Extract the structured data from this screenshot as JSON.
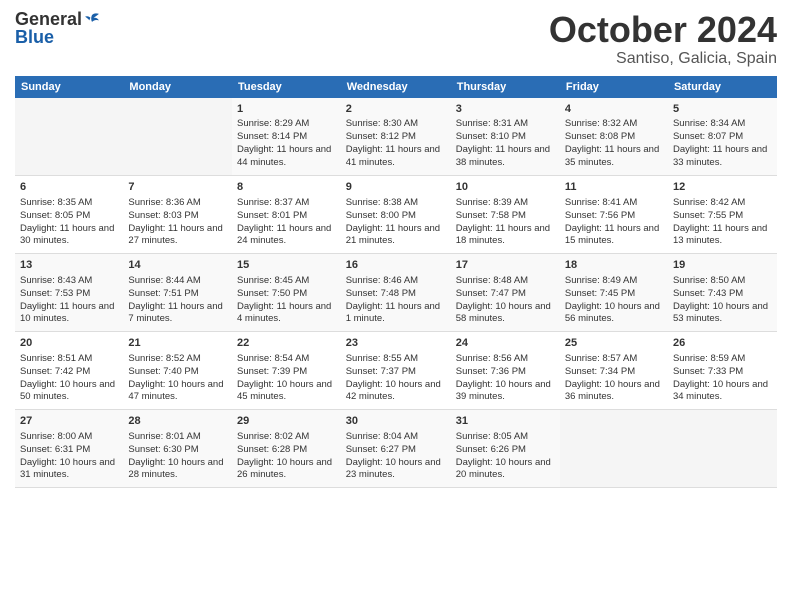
{
  "header": {
    "logo_general": "General",
    "logo_blue": "Blue",
    "month": "October 2024",
    "location": "Santiso, Galicia, Spain"
  },
  "weekdays": [
    "Sunday",
    "Monday",
    "Tuesday",
    "Wednesday",
    "Thursday",
    "Friday",
    "Saturday"
  ],
  "weeks": [
    [
      {
        "day": "",
        "info": ""
      },
      {
        "day": "",
        "info": ""
      },
      {
        "day": "1",
        "info": "Sunrise: 8:29 AM\nSunset: 8:14 PM\nDaylight: 11 hours and 44 minutes."
      },
      {
        "day": "2",
        "info": "Sunrise: 8:30 AM\nSunset: 8:12 PM\nDaylight: 11 hours and 41 minutes."
      },
      {
        "day": "3",
        "info": "Sunrise: 8:31 AM\nSunset: 8:10 PM\nDaylight: 11 hours and 38 minutes."
      },
      {
        "day": "4",
        "info": "Sunrise: 8:32 AM\nSunset: 8:08 PM\nDaylight: 11 hours and 35 minutes."
      },
      {
        "day": "5",
        "info": "Sunrise: 8:34 AM\nSunset: 8:07 PM\nDaylight: 11 hours and 33 minutes."
      }
    ],
    [
      {
        "day": "6",
        "info": "Sunrise: 8:35 AM\nSunset: 8:05 PM\nDaylight: 11 hours and 30 minutes."
      },
      {
        "day": "7",
        "info": "Sunrise: 8:36 AM\nSunset: 8:03 PM\nDaylight: 11 hours and 27 minutes."
      },
      {
        "day": "8",
        "info": "Sunrise: 8:37 AM\nSunset: 8:01 PM\nDaylight: 11 hours and 24 minutes."
      },
      {
        "day": "9",
        "info": "Sunrise: 8:38 AM\nSunset: 8:00 PM\nDaylight: 11 hours and 21 minutes."
      },
      {
        "day": "10",
        "info": "Sunrise: 8:39 AM\nSunset: 7:58 PM\nDaylight: 11 hours and 18 minutes."
      },
      {
        "day": "11",
        "info": "Sunrise: 8:41 AM\nSunset: 7:56 PM\nDaylight: 11 hours and 15 minutes."
      },
      {
        "day": "12",
        "info": "Sunrise: 8:42 AM\nSunset: 7:55 PM\nDaylight: 11 hours and 13 minutes."
      }
    ],
    [
      {
        "day": "13",
        "info": "Sunrise: 8:43 AM\nSunset: 7:53 PM\nDaylight: 11 hours and 10 minutes."
      },
      {
        "day": "14",
        "info": "Sunrise: 8:44 AM\nSunset: 7:51 PM\nDaylight: 11 hours and 7 minutes."
      },
      {
        "day": "15",
        "info": "Sunrise: 8:45 AM\nSunset: 7:50 PM\nDaylight: 11 hours and 4 minutes."
      },
      {
        "day": "16",
        "info": "Sunrise: 8:46 AM\nSunset: 7:48 PM\nDaylight: 11 hours and 1 minute."
      },
      {
        "day": "17",
        "info": "Sunrise: 8:48 AM\nSunset: 7:47 PM\nDaylight: 10 hours and 58 minutes."
      },
      {
        "day": "18",
        "info": "Sunrise: 8:49 AM\nSunset: 7:45 PM\nDaylight: 10 hours and 56 minutes."
      },
      {
        "day": "19",
        "info": "Sunrise: 8:50 AM\nSunset: 7:43 PM\nDaylight: 10 hours and 53 minutes."
      }
    ],
    [
      {
        "day": "20",
        "info": "Sunrise: 8:51 AM\nSunset: 7:42 PM\nDaylight: 10 hours and 50 minutes."
      },
      {
        "day": "21",
        "info": "Sunrise: 8:52 AM\nSunset: 7:40 PM\nDaylight: 10 hours and 47 minutes."
      },
      {
        "day": "22",
        "info": "Sunrise: 8:54 AM\nSunset: 7:39 PM\nDaylight: 10 hours and 45 minutes."
      },
      {
        "day": "23",
        "info": "Sunrise: 8:55 AM\nSunset: 7:37 PM\nDaylight: 10 hours and 42 minutes."
      },
      {
        "day": "24",
        "info": "Sunrise: 8:56 AM\nSunset: 7:36 PM\nDaylight: 10 hours and 39 minutes."
      },
      {
        "day": "25",
        "info": "Sunrise: 8:57 AM\nSunset: 7:34 PM\nDaylight: 10 hours and 36 minutes."
      },
      {
        "day": "26",
        "info": "Sunrise: 8:59 AM\nSunset: 7:33 PM\nDaylight: 10 hours and 34 minutes."
      }
    ],
    [
      {
        "day": "27",
        "info": "Sunrise: 8:00 AM\nSunset: 6:31 PM\nDaylight: 10 hours and 31 minutes."
      },
      {
        "day": "28",
        "info": "Sunrise: 8:01 AM\nSunset: 6:30 PM\nDaylight: 10 hours and 28 minutes."
      },
      {
        "day": "29",
        "info": "Sunrise: 8:02 AM\nSunset: 6:28 PM\nDaylight: 10 hours and 26 minutes."
      },
      {
        "day": "30",
        "info": "Sunrise: 8:04 AM\nSunset: 6:27 PM\nDaylight: 10 hours and 23 minutes."
      },
      {
        "day": "31",
        "info": "Sunrise: 8:05 AM\nSunset: 6:26 PM\nDaylight: 10 hours and 20 minutes."
      },
      {
        "day": "",
        "info": ""
      },
      {
        "day": "",
        "info": ""
      }
    ]
  ]
}
